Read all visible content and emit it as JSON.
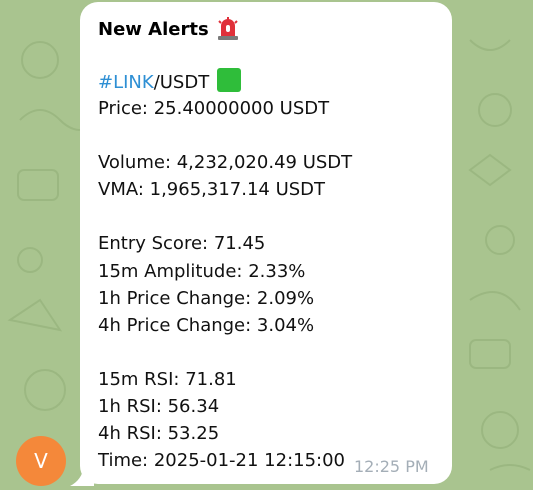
{
  "message": {
    "title": "New Alerts",
    "title_emoji": "siren-icon",
    "pair_tag": "#LINK",
    "pair_rest": "/USDT",
    "pair_emoji": "green-square-icon",
    "lines": [
      "Price: 25.40000000 USDT",
      "Volume: 4,232,020.49 USDT",
      "VMA: 1,965,317.14 USDT",
      "Entry Score: 71.45",
      "15m Amplitude: 2.33%",
      "1h Price Change: 2.09%",
      "4h Price Change: 3.04%",
      "15m RSI: 71.81",
      "1h RSI: 56.34",
      "4h RSI: 53.25",
      "Time: 2025-01-21 12:15:00"
    ],
    "timestamp": "12:25 PM"
  },
  "avatar": {
    "initial": "V",
    "color": "#f4883a"
  },
  "colors": {
    "wallpaper": "#a9c48f",
    "hashtag": "#2e8fd4",
    "bubble": "#ffffff"
  }
}
